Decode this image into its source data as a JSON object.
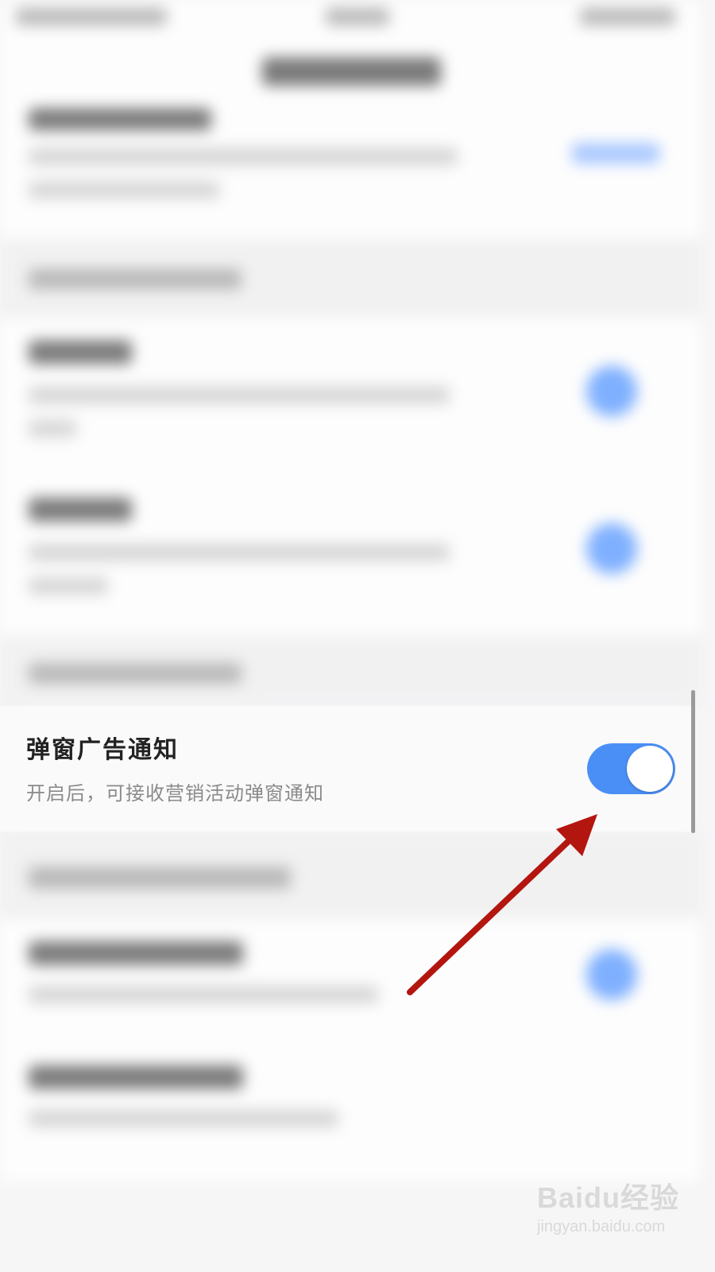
{
  "popup_ad_setting": {
    "title": "弹窗广告通知",
    "description": "开启后，可接收营销活动弹窗通知",
    "toggle_on": true
  },
  "colors": {
    "accent": "#4a8ff6",
    "annotation_arrow": "#b3160f"
  },
  "watermark": {
    "logo": "Baidu经验",
    "url": "jingyan.baidu.com"
  }
}
